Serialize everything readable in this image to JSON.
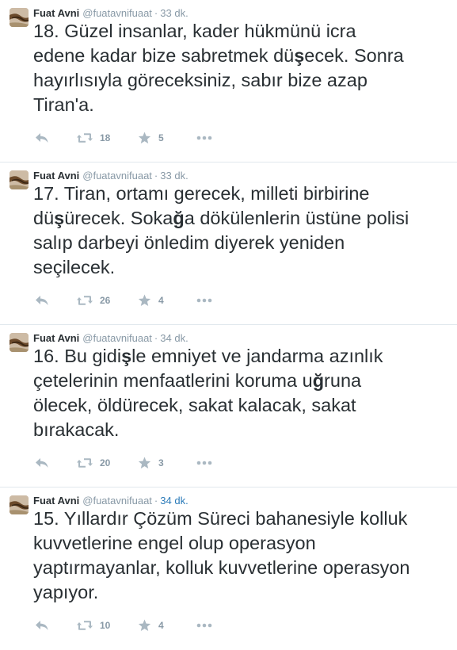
{
  "colors": {
    "name": "#292f33",
    "meta": "#8899a6",
    "highlight_time": "#2b7bb9",
    "divider": "#e1e8ed"
  },
  "tweets": [
    {
      "name": "Fuat Avni",
      "handle": "@fuatavnifuaat",
      "dot": "·",
      "time": "33 dk.",
      "time_highlight": false,
      "text_parts": [
        {
          "t": "18. Güzel insanlar, kader hükmünü icra\nedene kadar bize sabretmek dü"
        },
        {
          "t": "ş",
          "b": true
        },
        {
          "t": "ecek. Sonra\nhayırlısıyla göreceksiniz, sabır bize azap\nTiran'a."
        }
      ],
      "retweets": "18",
      "favorites": "5"
    },
    {
      "name": "Fuat Avni",
      "handle": "@fuatavnifuaat",
      "dot": "·",
      "time": "33 dk.",
      "time_highlight": false,
      "text_parts": [
        {
          "t": "17. Tiran, ortamı gerecek, milleti birbirine\ndü"
        },
        {
          "t": "ş",
          "b": true
        },
        {
          "t": "ürecek. Soka"
        },
        {
          "t": "ğ",
          "b": true
        },
        {
          "t": "a dökülenlerin üstüne polisi\nsalıp darbeyi önledim diyerek yeniden\nseçilecek."
        }
      ],
      "retweets": "26",
      "favorites": "4"
    },
    {
      "name": "Fuat Avni",
      "handle": "@fuatavnifuaat",
      "dot": "·",
      "time": "34 dk.",
      "time_highlight": false,
      "text_parts": [
        {
          "t": "16. Bu gidi"
        },
        {
          "t": "ş",
          "b": true
        },
        {
          "t": "le emniyet ve jandarma azınlık\nçetelerinin menfaatlerini koruma u"
        },
        {
          "t": "ğ",
          "b": true
        },
        {
          "t": "runa\nölecek, öldürecek, sakat kalacak, sakat\nbırakacak."
        }
      ],
      "retweets": "20",
      "favorites": "3"
    },
    {
      "name": "Fuat Avni",
      "handle": "@fuatavnifuaat",
      "dot": "·",
      "time": "34 dk.",
      "time_highlight": true,
      "text_parts": [
        {
          "t": "15. Yıllardır Çözüm Süreci bahanesiyle kolluk\nkuvvetlerine engel olup operasyon\nyaptırmayanlar, kolluk kuvvetlerine operasyon\nyapıyor."
        }
      ],
      "retweets": "10",
      "favorites": "4"
    }
  ]
}
